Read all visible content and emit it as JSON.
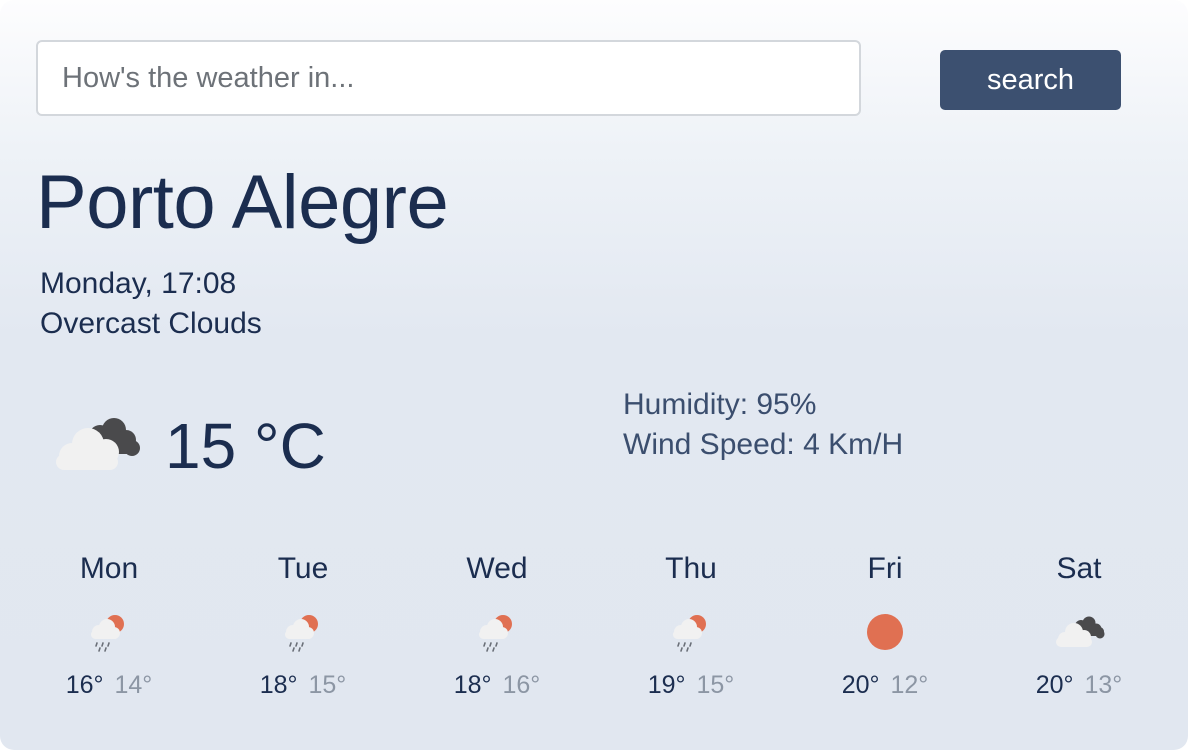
{
  "search": {
    "placeholder": "How's the weather in...",
    "value": "",
    "button_label": "search"
  },
  "current": {
    "city": "Porto Alegre",
    "datetime": "Monday, 17:08",
    "description": "Overcast Clouds",
    "temperature": "15 °C",
    "icon": "overcast-clouds-icon",
    "humidity": "Humidity: 95%",
    "wind_speed": "Wind Speed: 4 Km/H"
  },
  "forecast": [
    {
      "day": "Mon",
      "max": "16°",
      "min": "14°",
      "icon": "rain-sun-icon"
    },
    {
      "day": "Tue",
      "max": "18°",
      "min": "15°",
      "icon": "rain-sun-icon"
    },
    {
      "day": "Wed",
      "max": "18°",
      "min": "16°",
      "icon": "rain-sun-icon"
    },
    {
      "day": "Thu",
      "max": "19°",
      "min": "15°",
      "icon": "rain-sun-icon"
    },
    {
      "day": "Fri",
      "max": "20°",
      "min": "12°",
      "icon": "sun-icon"
    },
    {
      "day": "Sat",
      "max": "20°",
      "min": "13°",
      "icon": "overcast-clouds-icon"
    }
  ],
  "colors": {
    "primary_text": "#1b2d4f",
    "secondary_text": "#3b4e6e",
    "min_temp": "#8c96a4",
    "button": "#3c5070",
    "sun": "#e07052"
  }
}
